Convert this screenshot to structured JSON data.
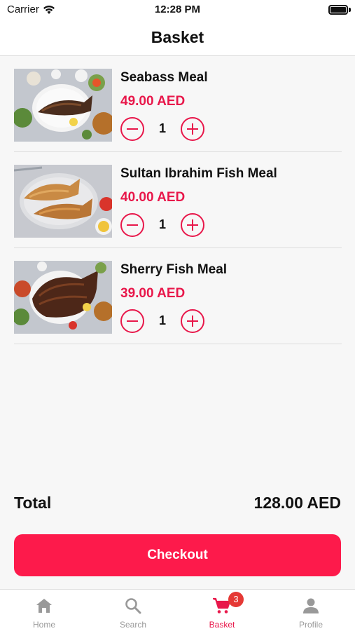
{
  "status_bar": {
    "carrier": "Carrier",
    "time": "12:28 PM"
  },
  "header": {
    "title": "Basket"
  },
  "items": [
    {
      "name": "Seabass Meal",
      "price": "49.00 AED",
      "quantity": "1"
    },
    {
      "name": "Sultan Ibrahim Fish Meal",
      "price": "40.00 AED",
      "quantity": "1"
    },
    {
      "name": "Sherry Fish Meal",
      "price": "39.00 AED",
      "quantity": "1"
    }
  ],
  "summary": {
    "total_label": "Total",
    "total_value": "128.00 AED"
  },
  "checkout": {
    "label": "Checkout"
  },
  "tabs": [
    {
      "label": "Home",
      "icon": "home-icon"
    },
    {
      "label": "Search",
      "icon": "search-icon"
    },
    {
      "label": "Basket",
      "icon": "cart-icon",
      "badge": "3",
      "active": true
    },
    {
      "label": "Profile",
      "icon": "profile-icon"
    }
  ],
  "colors": {
    "accent": "#e8174a",
    "checkout_bg": "#fd1a4b",
    "badge": "#e53935",
    "inactive_tab": "#999999"
  }
}
